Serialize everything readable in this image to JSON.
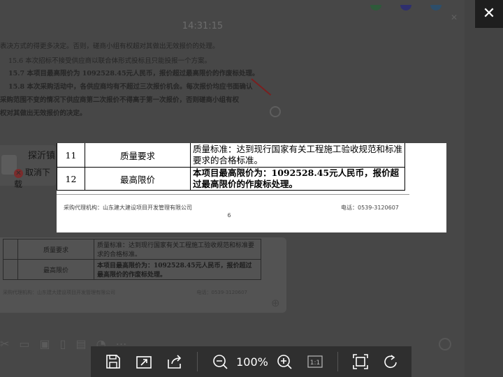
{
  "background": {
    "time": "14:31:15",
    "doc_lines": [
      {
        "text": "表决方式的得更多决定。否则，磋商小组有权超对其做出无效报价的处理。",
        "bold": false
      },
      {
        "text": "15.6 本次招标不接受供应商以联合体形式投标且只能投报一个方案。",
        "bold": false
      },
      {
        "text": "15.7 本项目最高限价为 1092528.45元人民币，报价超过最高限价的作废标处理。",
        "bold": true
      },
      {
        "text": "15.8 本次采购活动中，各供应商均有不超过三次报价机会。每次报价均应书面确认",
        "bold": true
      },
      {
        "text": "采购范围不变的情况下供应商第二次报价不得高于第一次报价，否则磋商小组有权",
        "bold": true
      },
      {
        "text": "权对其做出无效报价的决定。",
        "bold": true
      }
    ],
    "file_name": "探沂镇",
    "file_cancel": "取消下载",
    "card_rows": [
      {
        "item": "质量要求",
        "desc": "质量标准：达到现行国家有关工程施工验收规范和标准要求的合格标准。"
      },
      {
        "item": "最高限价",
        "desc": "本项目最高限价为：1092528.45元人民币，报价超过最高限价的作废标处理。"
      }
    ],
    "card_footer": "采购代理机构：山东建大建设项目开发管理有限公司",
    "card_footer_phone": "电话：0539-3120607"
  },
  "document": {
    "rows": [
      {
        "no": "11",
        "item": "质量要求",
        "desc": "质量标准：达到现行国家有关工程施工验收规范和标准要求的合格标准。",
        "bold": false
      },
      {
        "no": "12",
        "item": "最高限价",
        "desc": "本项目最高限价为：1092528.45元人民币，报价超过最高限价的作废标处理。",
        "bold": true
      }
    ],
    "agency": "采购代理机构：山东建大建设项目开发管理有限公司",
    "phone": "电话：0539-3120607",
    "page_number": "6"
  },
  "viewer": {
    "close_icon": "close-icon",
    "zoom_level": "100%",
    "actual_size_label": "1:1"
  }
}
